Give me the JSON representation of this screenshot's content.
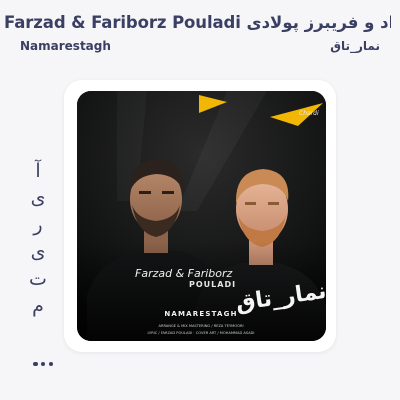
{
  "header": {
    "artist_en": "Farzad & Fariborz Pouladi",
    "artist_fa": "فرزاد و فریبرز پولادی",
    "track_en": "Namarestagh",
    "track_fa": "نمار_تاق"
  },
  "vertical_label": {
    "letters": [
      "آ",
      "ی",
      "ر",
      "ی",
      "ت",
      "م"
    ]
  },
  "cover": {
    "signature": "Chardi",
    "artists_script": "Farzad & Fariborz",
    "artists_surname": "POULADI",
    "title_fa": "نمار_تاق",
    "title_en": "NAMARESTAGH",
    "credits_line1": "ARRANGE & MIX MASTERING / REZA TEYMOORI",
    "credits_line2": "LYRIC / FARZAD POULADI · COVER ART / MOHAMMAD ASADI"
  },
  "more": {
    "icon": "more-dots-icon"
  },
  "colors": {
    "text": "#3a3f63",
    "background": "#f6f6f8",
    "card": "#ffffff",
    "accent_yellow": "#f2b705"
  }
}
